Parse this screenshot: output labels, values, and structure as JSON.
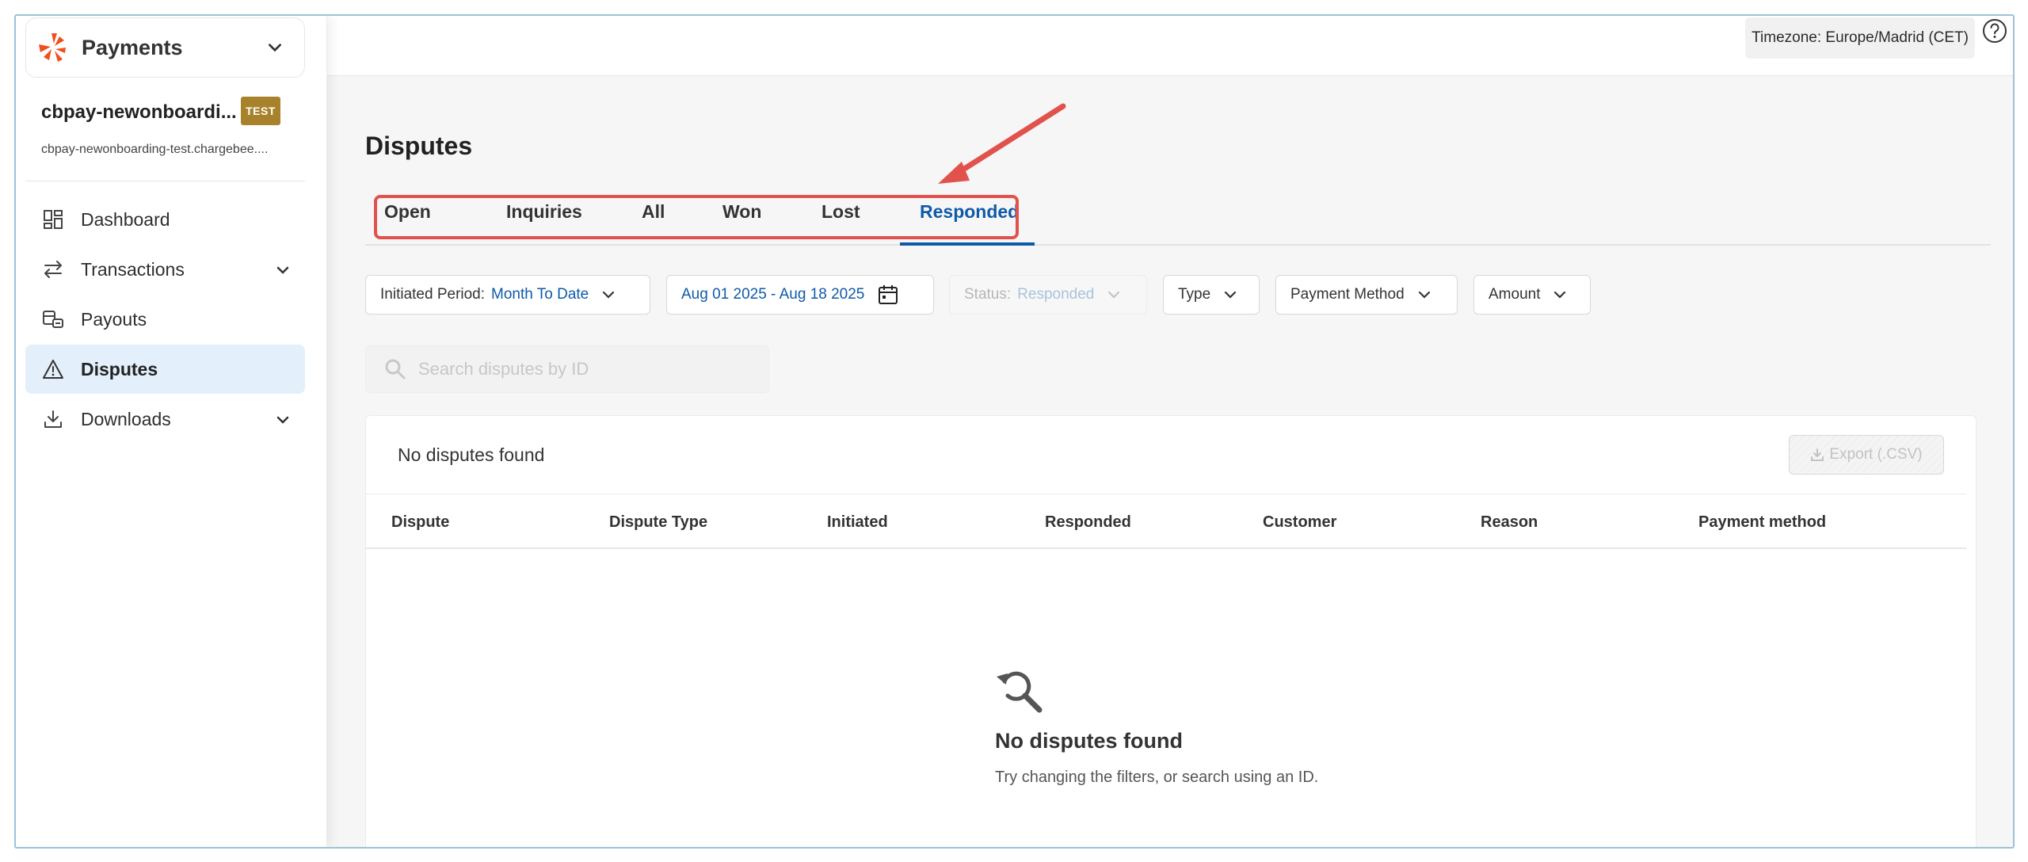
{
  "app": {
    "name": "Payments",
    "logo": "chargebee-logo",
    "brand_color": "#f24e1e"
  },
  "site": {
    "name": "cbpay-newonboardi...",
    "badge": "TEST",
    "domain": "cbpay-newonboarding-test.chargebee...."
  },
  "sidebar": {
    "items": [
      {
        "label": "Dashboard",
        "icon": "dashboard-icon",
        "has_chevron": false,
        "active": false
      },
      {
        "label": "Transactions",
        "icon": "transactions-icon",
        "has_chevron": true,
        "active": false
      },
      {
        "label": "Payouts",
        "icon": "payouts-icon",
        "has_chevron": false,
        "active": false
      },
      {
        "label": "Disputes",
        "icon": "warning-triangle-icon",
        "has_chevron": false,
        "active": true
      },
      {
        "label": "Downloads",
        "icon": "download-icon",
        "has_chevron": true,
        "active": false
      }
    ]
  },
  "topbar": {
    "timezone": "Timezone: Europe/Madrid (CET)",
    "help_icon": "help-icon"
  },
  "page": {
    "title": "Disputes"
  },
  "tabs": {
    "items": [
      "Open",
      "Inquiries",
      "All",
      "Won",
      "Lost",
      "Responded"
    ],
    "active": "Responded"
  },
  "filters": {
    "initiated_label": "Initiated Period:",
    "initiated_value": "Month To Date",
    "date_range": "Aug 01 2025 - Aug 18 2025",
    "status_label": "Status:",
    "status_value": "Responded",
    "type_label": "Type",
    "payment_method_label": "Payment Method",
    "amount_label": "Amount"
  },
  "search": {
    "placeholder": "Search disputes by ID"
  },
  "table": {
    "summary": "No disputes found",
    "export_label": "Export (.CSV)",
    "columns": [
      "Dispute",
      "Dispute Type",
      "Initiated",
      "Responded",
      "Customer",
      "Reason",
      "Payment method"
    ]
  },
  "empty_state": {
    "title": "No disputes found",
    "subtitle": "Try changing the filters, or search using an ID."
  },
  "colors": {
    "accent": "#0e5aa8",
    "highlight": "#e2524c",
    "active_nav_bg": "#e3effa",
    "badge": "#a8822a"
  }
}
